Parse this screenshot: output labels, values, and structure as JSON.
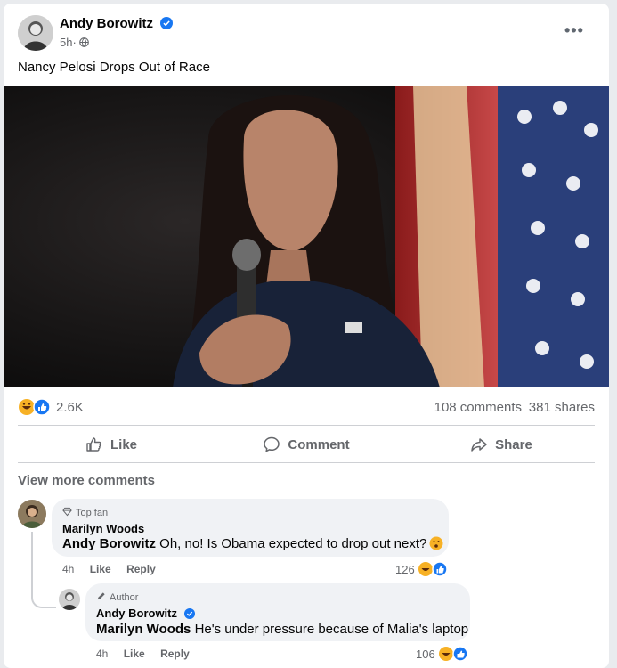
{
  "post": {
    "author": "Andy Borowitz",
    "time": "5h",
    "separator": "·",
    "text": "Nancy Pelosi Drops Out of Race",
    "more_glyph": "•••"
  },
  "stats": {
    "reactions": "2.6K",
    "comments": "108 comments",
    "shares": "381 shares",
    "reaction_icons": [
      "haha-icon",
      "like-icon"
    ]
  },
  "actions": {
    "like": "Like",
    "comment": "Comment",
    "share": "Share"
  },
  "view_more_comments": "View more comments",
  "comments": [
    {
      "badge": "Top fan",
      "author": "Marilyn Woods",
      "mention": "Andy Borowitz",
      "text": " Oh, no! Is Obama expected to drop out next?",
      "emoji": "surprised-face-icon",
      "time": "4h",
      "like": "Like",
      "reply": "Reply",
      "reaction_count": "126"
    },
    {
      "badge": "Author",
      "author": "Andy Borowitz",
      "mention": "Marilyn Woods",
      "text": " He's under pressure because of Malia's laptop",
      "time": "4h",
      "like": "Like",
      "reply": "Reply",
      "reaction_count": "106"
    }
  ],
  "colors": {
    "accent": "#1877f2",
    "muted": "#65676b",
    "bubble": "#f0f2f5",
    "haha": "#f7b125"
  }
}
